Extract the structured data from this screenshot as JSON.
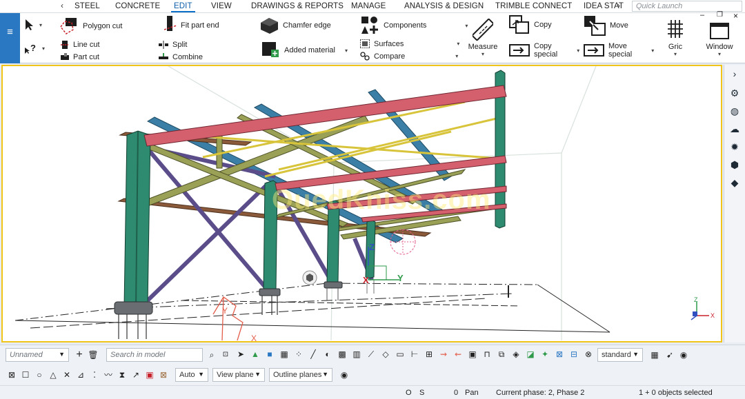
{
  "menu": {
    "tabs": [
      "STEEL",
      "CONCRETE",
      "EDIT",
      "VIEW",
      "DRAWINGS & REPORTS",
      "MANAGE",
      "ANALYSIS & DESIGN",
      "TRIMBLE CONNECT",
      "IDEA STAT"
    ],
    "active_tab": "EDIT",
    "quick_launch_placeholder": "Quick Launch"
  },
  "ribbon": {
    "polygon_cut": "Polygon cut",
    "line_cut": "Line cut",
    "part_cut": "Part cut",
    "fit_part_end": "Fit part end",
    "split": "Split",
    "combine": "Combine",
    "chamfer_edge": "Chamfer edge",
    "added_material": "Added material",
    "components": "Components",
    "surfaces": "Surfaces",
    "compare": "Compare",
    "measure": "Measure",
    "copy": "Copy",
    "copy_special_1": "Copy",
    "copy_special_2": "special",
    "move": "Move",
    "move_special_1": "Move",
    "move_special_2": "special",
    "grid": "Gric",
    "window": "Window"
  },
  "viewport": {
    "watermark": "OuedKniss.com",
    "axis_z": "Z",
    "axis_x": "X",
    "axis_y": "Y",
    "mini_axis_z": "Z",
    "mini_axis_x": "X",
    "grid_y_label": "Y",
    "grid_x_label": "X"
  },
  "toolbar": {
    "model_name": "Unnamed",
    "search_placeholder": "Search in model",
    "standard": "standard",
    "auto": "Auto",
    "view_plane": "View plane",
    "outline_planes": "Outline planes"
  },
  "status": {
    "o": "O",
    "s": "S",
    "pan_count": "0",
    "pan": "Pan",
    "phase": "Current phase: 2, Phase 2",
    "selected": "1 + 0 objects selected"
  },
  "colors": {
    "accent": "#2b78c2",
    "viewport_border": "#f0c419",
    "column": "#2e8b6f",
    "beam_red": "#d4606e",
    "beam_blue": "#3b7fa6",
    "brace_purple": "#6a5a9a",
    "purlin_olive": "#9aa055",
    "yellow_rod": "#d8c43a",
    "brown_beam": "#8a5a3a"
  }
}
